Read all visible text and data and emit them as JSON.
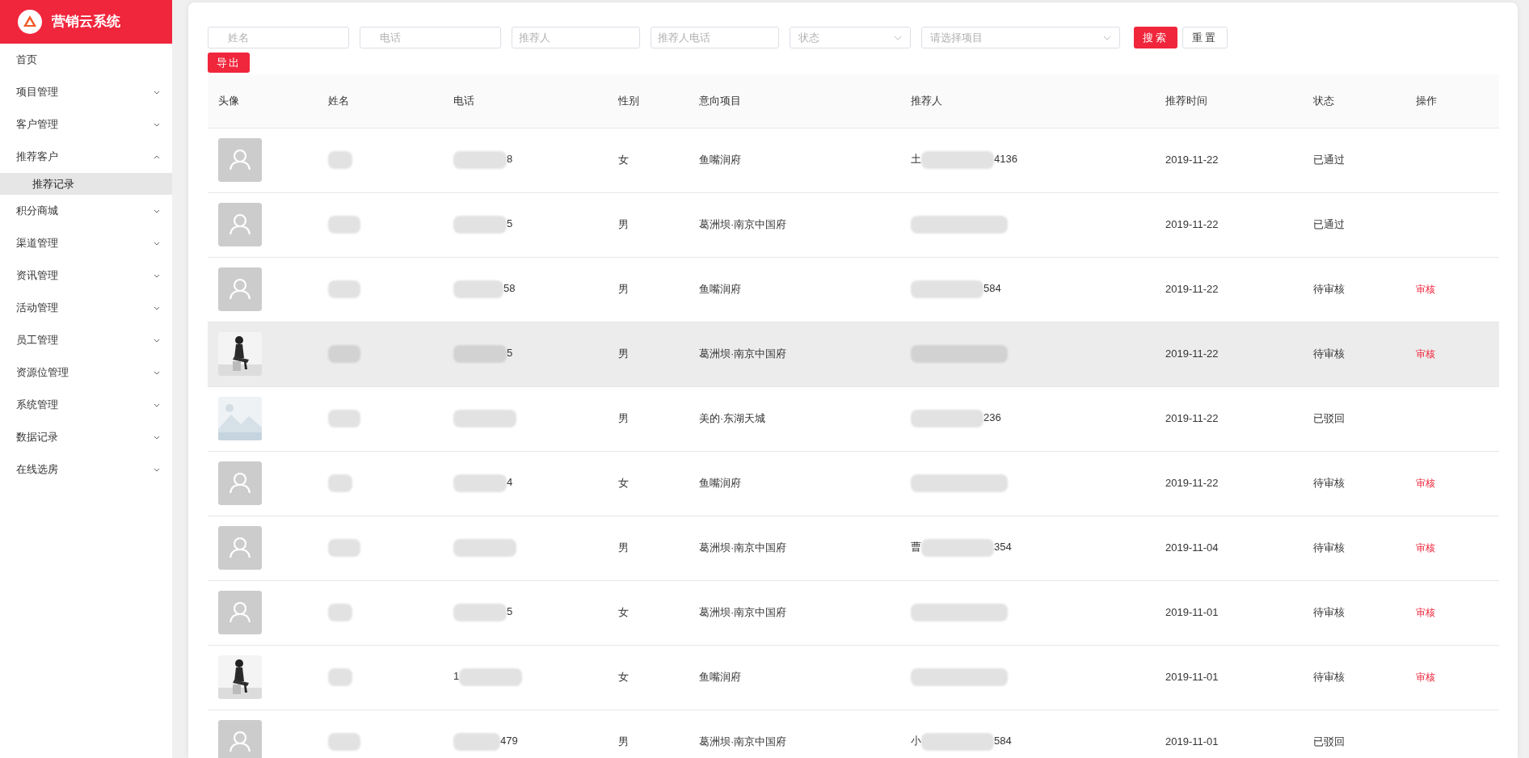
{
  "brand": {
    "title": "营销云系统"
  },
  "sidebar": {
    "items": [
      {
        "label": "首页"
      },
      {
        "label": "项目管理",
        "expanded": false
      },
      {
        "label": "客户管理",
        "expanded": false
      },
      {
        "label": "推荐客户",
        "expanded": true,
        "children": [
          {
            "label": "推荐记录",
            "selected": true
          }
        ]
      },
      {
        "label": "积分商城",
        "expanded": false
      },
      {
        "label": "渠道管理",
        "expanded": false
      },
      {
        "label": "资讯管理",
        "expanded": false
      },
      {
        "label": "活动管理",
        "expanded": false
      },
      {
        "label": "员工管理",
        "expanded": false
      },
      {
        "label": "资源位管理",
        "expanded": false
      },
      {
        "label": "系统管理",
        "expanded": false
      },
      {
        "label": "数据记录",
        "expanded": false
      },
      {
        "label": "在线选房",
        "expanded": false
      }
    ]
  },
  "filters": [
    {
      "kind": "input",
      "placeholder": "姓名"
    },
    {
      "kind": "input",
      "placeholder": "电话"
    },
    {
      "kind": "input",
      "placeholder": "推荐人"
    },
    {
      "kind": "input",
      "placeholder": "推荐人电话"
    },
    {
      "kind": "select",
      "placeholder": "状态"
    },
    {
      "kind": "select",
      "placeholder": "请选择项目"
    }
  ],
  "buttons": [
    {
      "label": "搜索",
      "primary": true
    },
    {
      "label": "重置",
      "primary": false
    }
  ],
  "export_button": {
    "label": "导出"
  },
  "table": {
    "columns": [
      "头像",
      "姓名",
      "电话",
      "性别",
      "意向项目",
      "推荐人",
      "推荐时间",
      "状态",
      "操作"
    ],
    "rows": [
      {
        "avatar": {
          "kind": "placeholder"
        },
        "highlighted": false,
        "phone_pre": "",
        "phone_post": "8",
        "gender": "女",
        "project": "鱼嘴润府",
        "ref_pre": "土",
        "ref_post": "4136",
        "date": "2019-11-22",
        "status": "已通过",
        "action": ""
      },
      {
        "avatar": {
          "kind": "placeholder"
        },
        "highlighted": false,
        "phone_pre": "",
        "phone_post": "5",
        "gender": "男",
        "project": "葛洲坝·南京中国府",
        "ref_pre": "",
        "ref_post": "",
        "date": "2019-11-22",
        "status": "已通过",
        "action": ""
      },
      {
        "avatar": {
          "kind": "placeholder"
        },
        "highlighted": false,
        "phone_pre": "",
        "phone_post": "58",
        "gender": "男",
        "project": "鱼嘴润府",
        "ref_pre": "",
        "ref_post": "584",
        "date": "2019-11-22",
        "status": "待审核",
        "action": "审核"
      },
      {
        "highlighted": true,
        "phone_pre": "",
        "phone_post": "5",
        "gender": "男",
        "project": "葛洲坝·南京中国府",
        "ref_pre": "",
        "ref_post": "",
        "date": "2019-11-22",
        "status": "待审核",
        "action": "审核"
      },
      {
        "highlighted": false,
        "phone_pre": "",
        "phone_post": "",
        "gender": "男",
        "project": "美的·东湖天城",
        "ref_pre": "",
        "ref_post": "236",
        "date": "2019-11-22",
        "status": "已驳回",
        "action": ""
      },
      {
        "avatar": {
          "kind": "placeholder"
        },
        "highlighted": false,
        "phone_pre": "",
        "phone_post": "4",
        "gender": "女",
        "project": "鱼嘴润府",
        "ref_pre": "",
        "ref_post": "",
        "date": "2019-11-22",
        "status": "待审核",
        "action": "审核"
      },
      {
        "avatar": {
          "kind": "placeholder"
        },
        "highlighted": false,
        "phone_pre": "",
        "phone_post": "",
        "gender": "男",
        "project": "葛洲坝·南京中国府",
        "ref_pre": "曹",
        "ref_post": "354",
        "date": "2019-11-04",
        "status": "待审核",
        "action": "审核"
      },
      {
        "avatar": {
          "kind": "placeholder"
        },
        "highlighted": false,
        "phone_pre": "",
        "phone_post": "5",
        "gender": "女",
        "project": "葛洲坝·南京中国府",
        "ref_pre": "",
        "ref_post": "",
        "date": "2019-11-01",
        "status": "待审核",
        "action": "审核"
      },
      {
        "highlighted": false,
        "phone_pre": "1",
        "phone_post": "",
        "gender": "女",
        "project": "鱼嘴润府",
        "ref_pre": "",
        "ref_post": "",
        "date": "2019-11-01",
        "status": "待审核",
        "action": "审核"
      },
      {
        "avatar": {
          "kind": "placeholder"
        },
        "highlighted": false,
        "phone_pre": "",
        "phone_post": "479",
        "gender": "男",
        "project": "葛洲坝·南京中国府",
        "ref_pre": "小",
        "ref_post": "584",
        "date": "2019-11-01",
        "status": "已驳回",
        "action": ""
      }
    ]
  }
}
